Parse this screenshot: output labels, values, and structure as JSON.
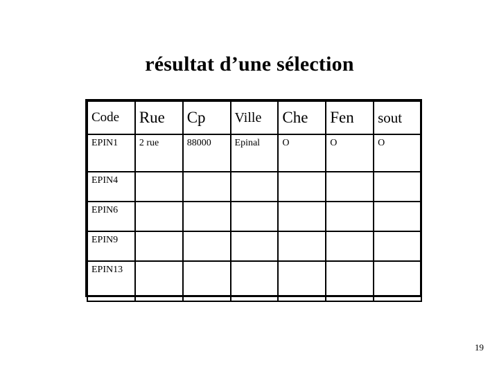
{
  "slide": {
    "title": "résultat d’une sélection",
    "page_number": "19",
    "background_color": "#ffffff",
    "text_color": "#000000",
    "border_color": "#000000"
  },
  "table": {
    "headers": [
      {
        "label": "Code"
      },
      {
        "label": "Rue"
      },
      {
        "label": "Cp"
      },
      {
        "label": "Ville"
      },
      {
        "label": "Che"
      },
      {
        "label": "Fen"
      },
      {
        "label": "sout"
      }
    ],
    "rows": [
      {
        "code": "EPIN1",
        "rue": "2 rue",
        "cp": "88000",
        "ville": "Epinal",
        "che": "O",
        "fen": "O",
        "sout": "O"
      },
      {
        "code": "EPIN4",
        "rue": "",
        "cp": "",
        "ville": "",
        "che": "",
        "fen": "",
        "sout": ""
      },
      {
        "code": "EPIN6",
        "rue": "",
        "cp": "",
        "ville": "",
        "che": "",
        "fen": "",
        "sout": ""
      },
      {
        "code": "EPIN9",
        "rue": "",
        "cp": "",
        "ville": "",
        "che": "",
        "fen": "",
        "sout": ""
      },
      {
        "code": "EPIN13",
        "rue": "",
        "cp": "",
        "ville": "",
        "che": "",
        "fen": "",
        "sout": ""
      }
    ]
  }
}
